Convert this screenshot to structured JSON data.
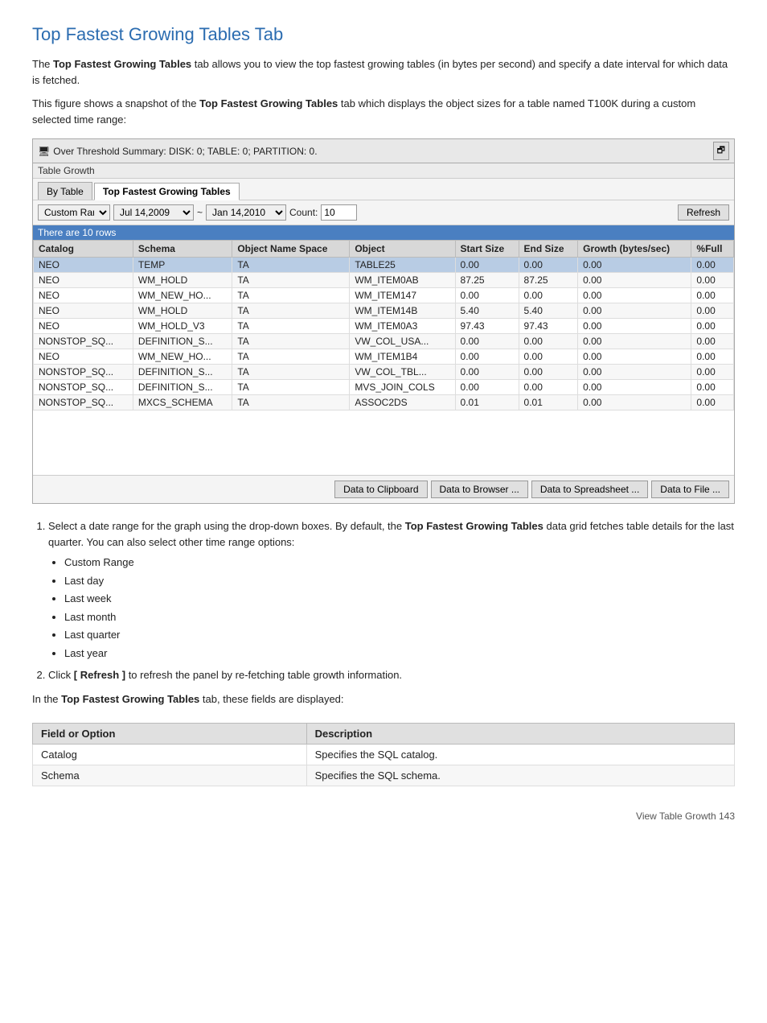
{
  "page": {
    "title": "Top Fastest Growing Tables Tab",
    "page_number": "View Table Growth    143"
  },
  "intro": {
    "para1": "The ",
    "para1_bold": "Top Fastest Growing Tables",
    "para1_rest": " tab allows you to view the top fastest growing tables (in bytes per second) and specify a date interval for which data is fetched.",
    "para2": "This figure shows a snapshot of the ",
    "para2_bold": "Top Fastest Growing Tables",
    "para2_rest": " tab which displays the object sizes for a table named T100K during a custom selected time range:"
  },
  "panel": {
    "header_text": "Over Threshold Summary: DISK: 0; TABLE: 0; PARTITION: 0.",
    "group_label": "Table Growth",
    "restore_icon": "🗗",
    "tabs": [
      {
        "label": "By Table",
        "active": false
      },
      {
        "label": "Top Fastest Growing Tables",
        "active": true
      }
    ],
    "controls": {
      "range_options": [
        "Custom Ran",
        "Last day",
        "Last week",
        "Last month",
        "Last quarter",
        "Last year"
      ],
      "range_selected": "Custom Ran",
      "date_from": "Jul 14,2009",
      "date_to": "Jan 14,2010",
      "count_label": "Count:",
      "count_value": "10",
      "refresh_label": "Refresh"
    },
    "row_count": "There are 10 rows",
    "table": {
      "columns": [
        "Catalog",
        "Schema",
        "Object Name Space",
        "Object",
        "Start Size",
        "End Size",
        "Growth (bytes/sec)",
        "%Full"
      ],
      "rows": [
        {
          "catalog": "NEO",
          "schema": "TEMP",
          "object_space": "TA",
          "object": "TABLE25",
          "start_size": "0.00",
          "end_size": "0.00",
          "growth": "0.00",
          "pct_full": "0.00",
          "highlight": true
        },
        {
          "catalog": "NEO",
          "schema": "WM_HOLD",
          "object_space": "TA",
          "object": "WM_ITEM0AB",
          "start_size": "87.25",
          "end_size": "87.25",
          "growth": "0.00",
          "pct_full": "0.00",
          "highlight": false
        },
        {
          "catalog": "NEO",
          "schema": "WM_NEW_HO...",
          "object_space": "TA",
          "object": "WM_ITEM147",
          "start_size": "0.00",
          "end_size": "0.00",
          "growth": "0.00",
          "pct_full": "0.00",
          "highlight": false
        },
        {
          "catalog": "NEO",
          "schema": "WM_HOLD",
          "object_space": "TA",
          "object": "WM_ITEM14B",
          "start_size": "5.40",
          "end_size": "5.40",
          "growth": "0.00",
          "pct_full": "0.00",
          "highlight": false
        },
        {
          "catalog": "NEO",
          "schema": "WM_HOLD_V3",
          "object_space": "TA",
          "object": "WM_ITEM0A3",
          "start_size": "97.43",
          "end_size": "97.43",
          "growth": "0.00",
          "pct_full": "0.00",
          "highlight": false
        },
        {
          "catalog": "NONSTOP_SQ...",
          "schema": "DEFINITION_S...",
          "object_space": "TA",
          "object": "VW_COL_USA...",
          "start_size": "0.00",
          "end_size": "0.00",
          "growth": "0.00",
          "pct_full": "0.00",
          "highlight": false
        },
        {
          "catalog": "NEO",
          "schema": "WM_NEW_HO...",
          "object_space": "TA",
          "object": "WM_ITEM1B4",
          "start_size": "0.00",
          "end_size": "0.00",
          "growth": "0.00",
          "pct_full": "0.00",
          "highlight": false
        },
        {
          "catalog": "NONSTOP_SQ...",
          "schema": "DEFINITION_S...",
          "object_space": "TA",
          "object": "VW_COL_TBL...",
          "start_size": "0.00",
          "end_size": "0.00",
          "growth": "0.00",
          "pct_full": "0.00",
          "highlight": false
        },
        {
          "catalog": "NONSTOP_SQ...",
          "schema": "DEFINITION_S...",
          "object_space": "TA",
          "object": "MVS_JOIN_COLS",
          "start_size": "0.00",
          "end_size": "0.00",
          "growth": "0.00",
          "pct_full": "0.00",
          "highlight": false
        },
        {
          "catalog": "NONSTOP_SQ...",
          "schema": "MXCS_SCHEMA",
          "object_space": "TA",
          "object": "ASSOC2DS",
          "start_size": "0.01",
          "end_size": "0.01",
          "growth": "0.00",
          "pct_full": "0.00",
          "highlight": false
        }
      ]
    },
    "bottom_buttons": [
      "Data to Clipboard",
      "Data to Browser ...",
      "Data to Spreadsheet ...",
      "Data to File ..."
    ]
  },
  "steps": {
    "step1_prefix": "Select a date range for the graph using the drop-down boxes. By default, the ",
    "step1_bold": "Top Fastest Growing Tables",
    "step1_rest": " data grid fetches table details for the last quarter. You can also select other time range options:",
    "step1_bullets": [
      "Custom Range",
      "Last day",
      "Last week",
      "Last month",
      "Last quarter",
      "Last year"
    ],
    "step2": "Click ",
    "step2_bold": "[ Refresh ]",
    "step2_rest": " to refresh the panel by re-fetching table growth information.",
    "step3_prefix": "In the ",
    "step3_bold": "Top Fastest Growing Tables",
    "step3_rest": " tab, these fields are displayed:"
  },
  "fields_table": {
    "columns": [
      "Field or Option",
      "Description"
    ],
    "rows": [
      {
        "field": "Catalog",
        "description": "Specifies the SQL catalog."
      },
      {
        "field": "Schema",
        "description": "Specifies the SQL schema."
      }
    ]
  }
}
